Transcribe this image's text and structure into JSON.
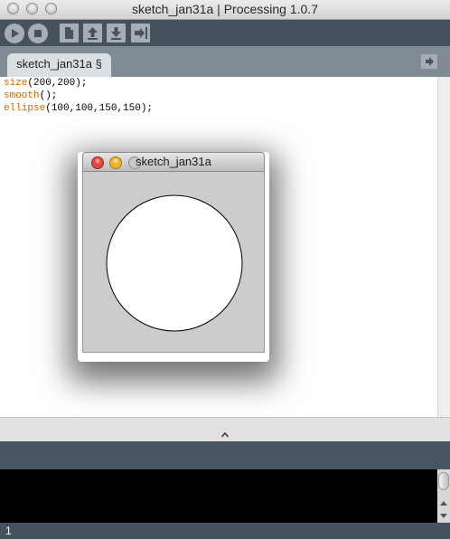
{
  "window": {
    "title": "sketch_jan31a | Processing 1.0.7"
  },
  "toolbar": {
    "buttons": [
      {
        "name": "run",
        "icon": "play-icon"
      },
      {
        "name": "stop",
        "icon": "stop-icon"
      },
      {
        "name": "new",
        "icon": "document-icon"
      },
      {
        "name": "open",
        "icon": "arrow-up-icon"
      },
      {
        "name": "save",
        "icon": "arrow-down-icon"
      },
      {
        "name": "export",
        "icon": "export-icon"
      }
    ]
  },
  "tabs": [
    {
      "label": "sketch_jan31a §",
      "active": true
    }
  ],
  "editor": {
    "lines": [
      {
        "keyword": "size",
        "rest": "(200,200);"
      },
      {
        "keyword": "smooth",
        "rest": "();"
      },
      {
        "keyword": "ellipse",
        "rest": "(100,100,150,150);"
      }
    ]
  },
  "sketch_window": {
    "title": "sketch_jan31a",
    "background": "#cccccc"
  },
  "status": {
    "line_number": "1"
  },
  "colors": {
    "keyword": "#cc6600",
    "toolbar": "#46525e",
    "tab_strip": "#818b95",
    "close_light": "#e0463f",
    "minimize_light": "#f2b233"
  }
}
